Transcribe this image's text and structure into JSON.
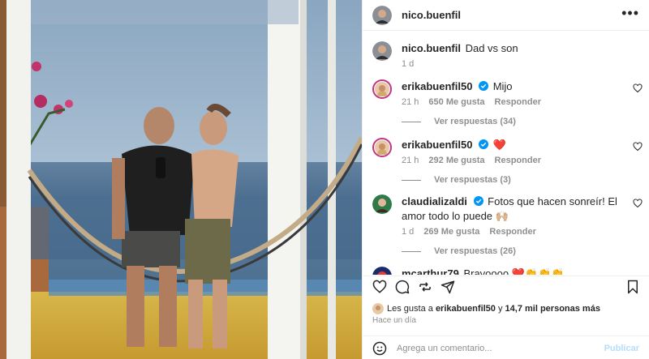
{
  "post": {
    "author": "nico.buenfil",
    "caption_user": "nico.buenfil",
    "caption": "Dad vs son",
    "caption_time": "1 d"
  },
  "comments": [
    {
      "user": "erikabuenfil50",
      "text": "Mijo",
      "time": "21 h",
      "likes": "650 Me gusta",
      "reply": "Responder",
      "view_replies": "Ver respuestas (34)"
    },
    {
      "user": "erikabuenfil50",
      "text": "❤️",
      "time": "21 h",
      "likes": "292 Me gusta",
      "reply": "Responder",
      "view_replies": "Ver respuestas (3)"
    },
    {
      "user": "claudializaldi",
      "text": "Fotos que hacen sonreír! El amor todo lo puede 🙌🏼",
      "time": "1 d",
      "likes": "269 Me gusta",
      "reply": "Responder",
      "view_replies": "Ver respuestas (26)"
    },
    {
      "user": "mcarthur79",
      "text": "Bravoooo ❤️👏👏👏"
    }
  ],
  "likes_line": {
    "prefix": "Les gusta a ",
    "user": "erikabuenfil50",
    "middle": " y ",
    "others": "14,7 mil personas más"
  },
  "time_ago": "Hace un día",
  "comment_box": {
    "placeholder": "Agrega un comentario...",
    "post_label": "Publicar"
  },
  "icons": [
    "heart-icon",
    "comment-icon",
    "share-icon",
    "send-icon",
    "bookmark-icon",
    "emoji-icon",
    "more-options-icon",
    "verified-icon"
  ],
  "colors": {
    "verified": "#0095f6",
    "post_disabled": "#b2dffc",
    "story_ring": "#c13584"
  }
}
